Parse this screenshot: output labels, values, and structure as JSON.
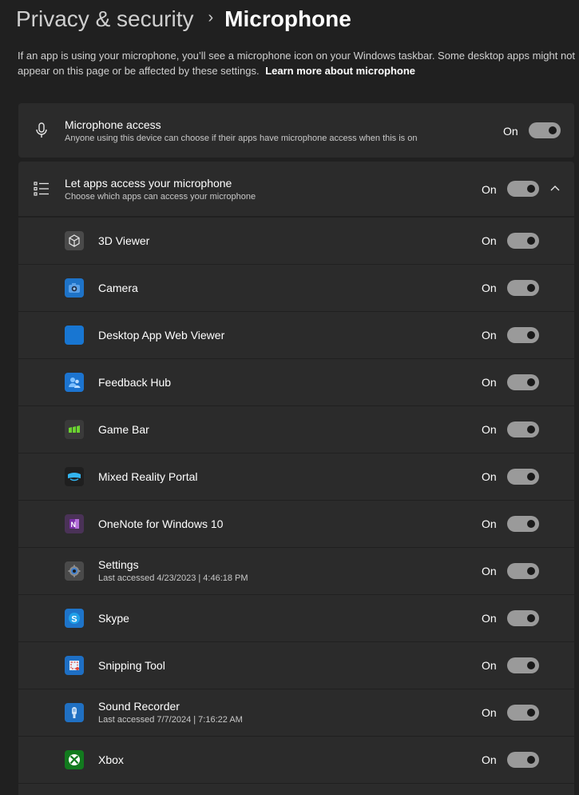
{
  "breadcrumb": {
    "parent": "Privacy & security",
    "separator": "›",
    "current": "Microphone"
  },
  "description": {
    "text": "If an app is using your microphone, you’ll see a microphone icon on your Windows taskbar. Some desktop apps might not appear on this page or be affected by these settings.",
    "link": "Learn more about microphone"
  },
  "microphone_access": {
    "title": "Microphone access",
    "subtitle": "Anyone using this device can choose if their apps have microphone access when this is on",
    "state": "On",
    "icon": "microphone-icon"
  },
  "apps_access": {
    "title": "Let apps access your microphone",
    "subtitle": "Choose which apps can access your microphone",
    "state": "On",
    "icon": "list-icon",
    "chevron": "chevron-up-icon"
  },
  "apps": [
    {
      "name": "3D Viewer",
      "state": "On",
      "icon": "cube-icon",
      "color": "#4a4a4a"
    },
    {
      "name": "Camera",
      "state": "On",
      "icon": "camera-icon",
      "color": "#1e73c8"
    },
    {
      "name": "Desktop App Web Viewer",
      "state": "On",
      "icon": "blank-app-icon",
      "color": "#1876d2"
    },
    {
      "name": "Feedback Hub",
      "state": "On",
      "icon": "people-icon",
      "color": "#1c74d0"
    },
    {
      "name": "Game Bar",
      "state": "On",
      "icon": "game-bar-icon",
      "color": "#3a3a3a"
    },
    {
      "name": "Mixed Reality Portal",
      "state": "On",
      "icon": "headset-icon",
      "color": "#1f1f1f"
    },
    {
      "name": "OneNote for Windows 10",
      "state": "On",
      "icon": "onenote-icon",
      "color": "#4a3257"
    },
    {
      "name": "Settings",
      "last_accessed": "Last accessed 4/23/2023  |  4:46:18 PM",
      "state": "On",
      "icon": "gear-icon",
      "color": "#4a4a4a"
    },
    {
      "name": "Skype",
      "state": "On",
      "icon": "skype-icon",
      "color": "#1e74c9"
    },
    {
      "name": "Snipping Tool",
      "state": "On",
      "icon": "snipping-icon",
      "color": "#1e6fc4"
    },
    {
      "name": "Sound Recorder",
      "last_accessed": "Last accessed 7/7/2024  |  7:16:22 AM",
      "state": "On",
      "icon": "recorder-icon",
      "color": "#2070c2"
    },
    {
      "name": "Xbox",
      "state": "On",
      "icon": "xbox-icon",
      "color": "#127a1e"
    }
  ]
}
